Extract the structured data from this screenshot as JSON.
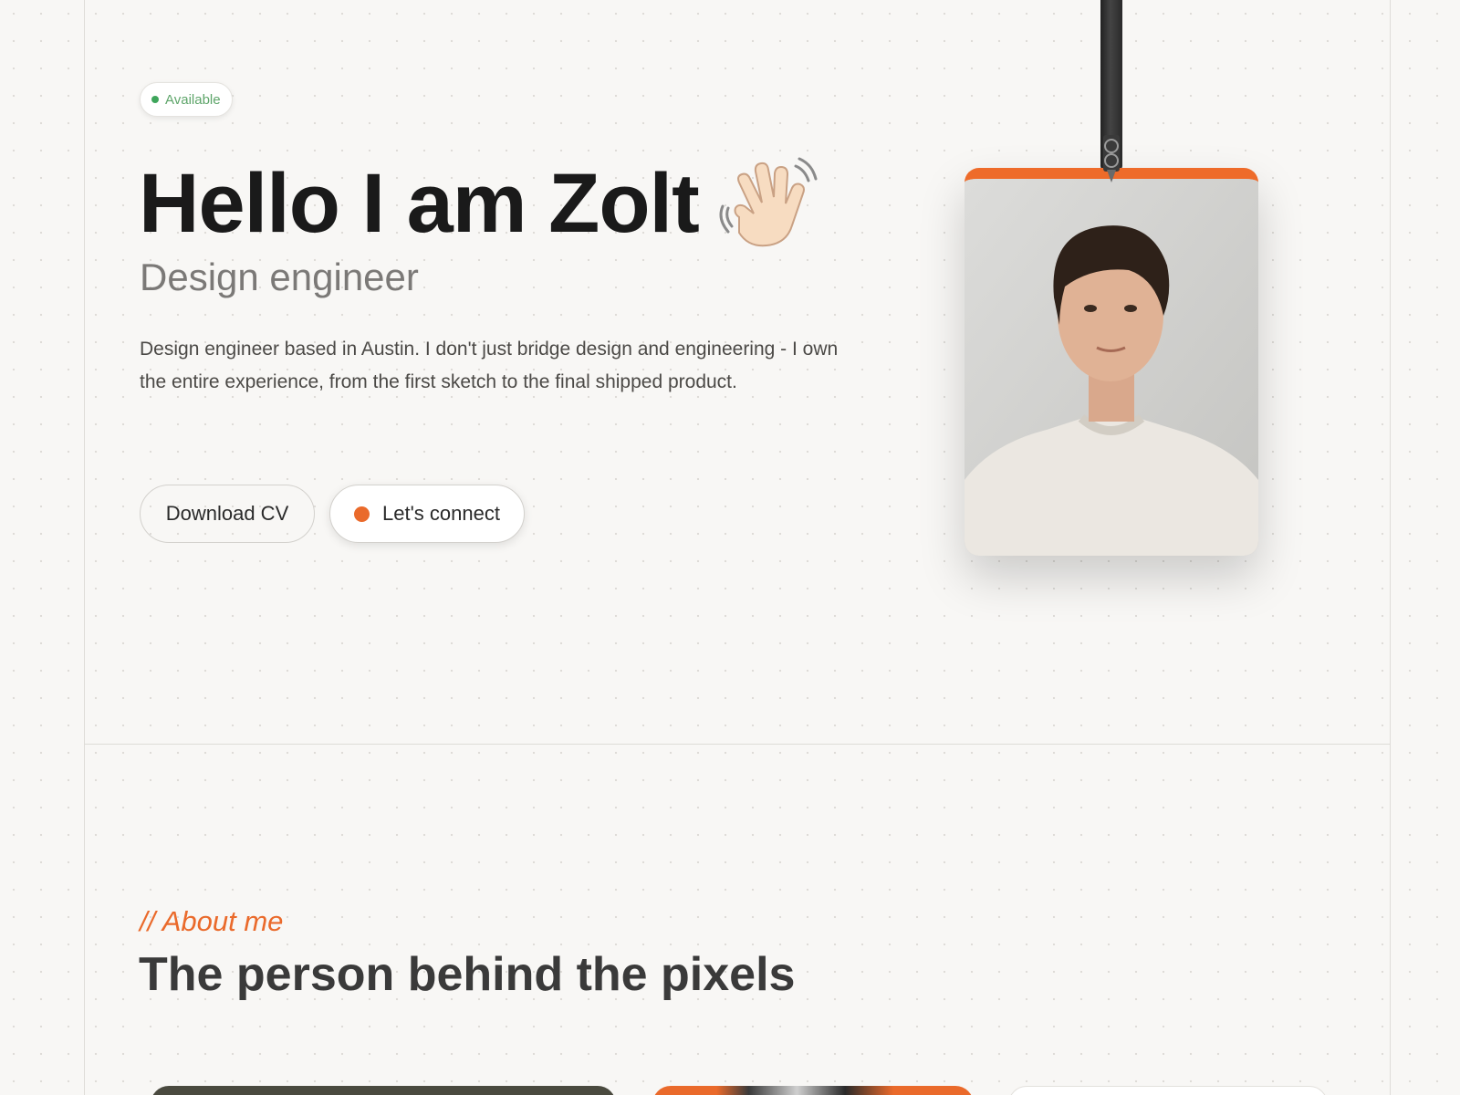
{
  "status_badge": {
    "label": "Available",
    "color": "#3ea55b"
  },
  "hero": {
    "title": "Hello I am Zolt",
    "subtitle": "Design engineer",
    "intro": "Design engineer based in Austin. I don't just bridge design and engineering - I own the entire experience, from the first sketch to the final shipped product.",
    "wave_icon": "waving-hand-icon"
  },
  "actions": {
    "download_cv": "Download CV",
    "connect": "Let's connect",
    "accent_color": "#ea6a2b"
  },
  "id_badge": {
    "photo": "portrait-photo",
    "accent_color": "#ee6b2a"
  },
  "about": {
    "label": "// About me",
    "title": "The person behind the pixels"
  }
}
